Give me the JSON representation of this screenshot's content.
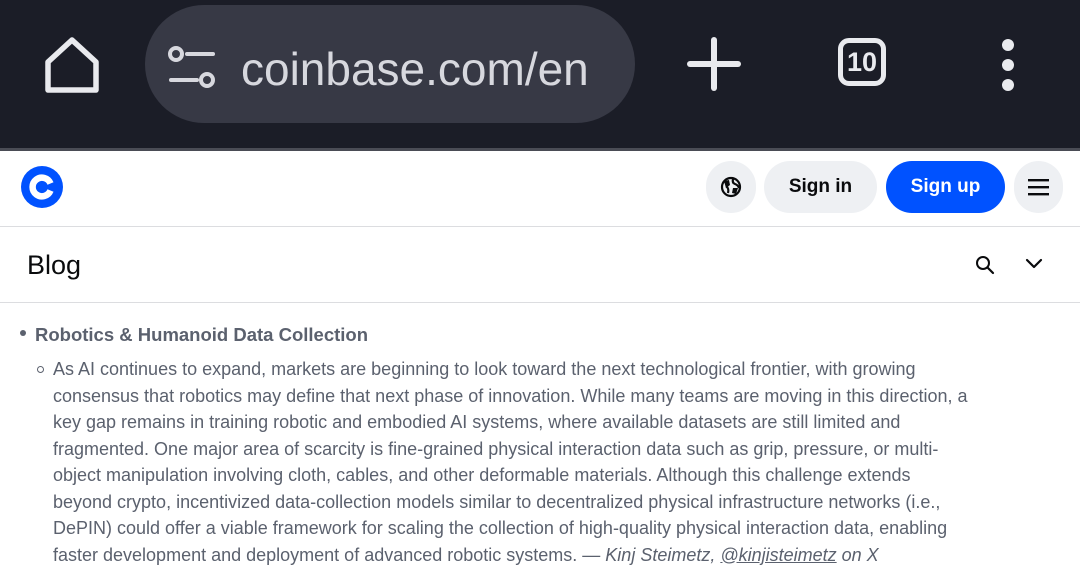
{
  "browser": {
    "url_display": "coinbase.com/en",
    "tab_count": "10",
    "icons": {
      "home": "home-icon",
      "site_settings": "tune-icon",
      "new_tab": "plus-icon",
      "menu": "more-vert-icon"
    }
  },
  "site_header": {
    "brand": "Coinbase",
    "brand_color": "#0052ff",
    "sign_in_label": "Sign in",
    "sign_up_label": "Sign up",
    "icons": {
      "language": "globe-icon",
      "menu": "hamburger-icon"
    }
  },
  "blog_bar": {
    "title": "Blog",
    "icons": {
      "search": "search-icon",
      "expand": "chevron-down-icon"
    }
  },
  "article": {
    "section_heading": "Robotics & Humanoid Data Collection",
    "paragraph_lines": [
      "As AI continues to expand, markets are beginning to look toward the next technological frontier, with growing",
      "consensus that robotics may define that next phase of innovation. While many teams are moving in this direction, a",
      "key gap remains in training robotic and embodied AI systems, where available datasets are still limited and",
      "fragmented. One major area of scarcity is fine-grained physical interaction data such as grip, pressure, or multi-",
      "object manipulation involving cloth, cables, and other deformable materials. Although this challenge extends",
      "beyond crypto, incentivized data-collection models similar to decentralized physical infrastructure networks (i.e.,",
      "DePIN) could offer a viable framework for scaling the collection of high-quality physical interaction data, enabling"
    ],
    "last_line_text": "faster development and deployment of advanced robotic systems. — ",
    "attribution_name": "Kinj Steimetz, ",
    "attribution_handle": "@kinjisteimetz",
    "attribution_suffix": " on X"
  }
}
